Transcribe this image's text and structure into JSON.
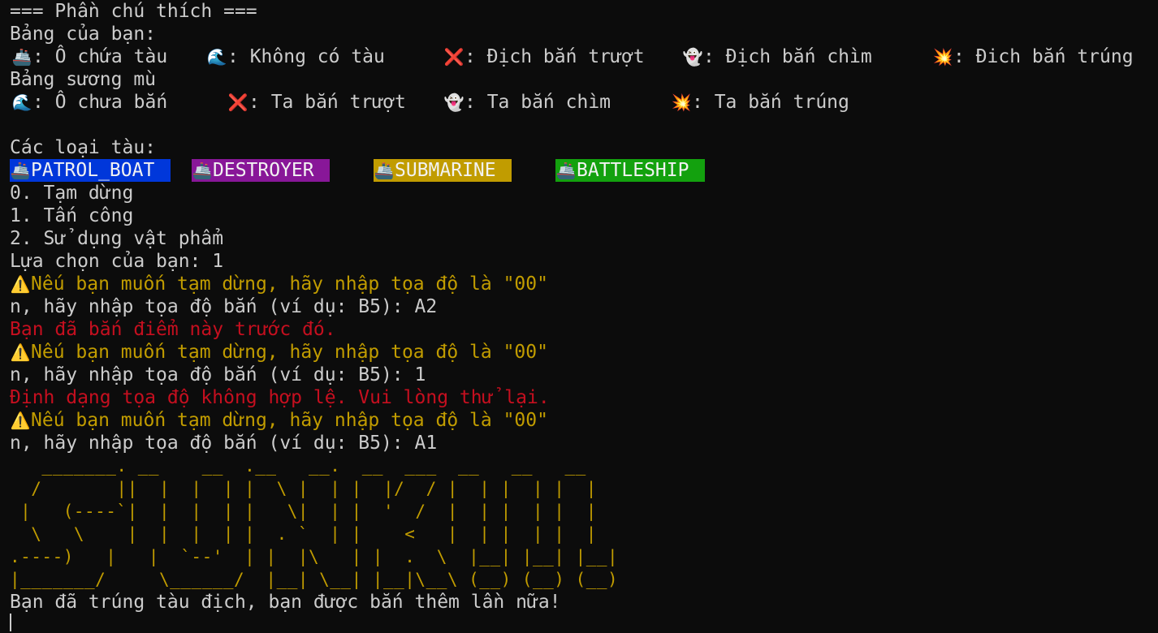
{
  "legend": {
    "header": "=== Phần chú thích ===",
    "own_board_title": "Bảng của bạn:",
    "own_board_items": [
      {
        "icon": "ship-icon",
        "glyph": "🚢",
        "text": ": Ô chứa tàu"
      },
      {
        "icon": "wave-icon",
        "glyph": "🌊",
        "text": ": Không có tàu"
      },
      {
        "icon": "cross-icon",
        "glyph": "❌",
        "text": ": Địch bắn trượt"
      },
      {
        "icon": "ghost-icon",
        "glyph": "👻",
        "text": ": Địch bắn chìm"
      },
      {
        "icon": "explosion-icon",
        "glyph": "💥",
        "text": ": Đich bắn trúng"
      }
    ],
    "fog_board_title": "Bảng sương mù",
    "fog_board_items": [
      {
        "icon": "wave-icon",
        "glyph": "🌊",
        "text": ": Ô chưa bắn"
      },
      {
        "icon": "cross-icon",
        "glyph": "❌",
        "text": ": Ta bắn trượt"
      },
      {
        "icon": "ghost-icon",
        "glyph": "👻",
        "text": ": Ta bắn chìm"
      },
      {
        "icon": "explosion-icon",
        "glyph": "💥",
        "text": ": Ta bắn trúng"
      }
    ]
  },
  "ships": {
    "title": "Các loại tàu:",
    "items": [
      {
        "glyph": "🚢",
        "name": "PATROL_BOAT",
        "color": "#0037da"
      },
      {
        "glyph": "🚢",
        "name": "DESTROYER",
        "color": "#881798"
      },
      {
        "glyph": "🚢",
        "name": "SUBMARINE",
        "color": "#c19c00"
      },
      {
        "glyph": "🚢",
        "name": "BATTLESHIP",
        "color": "#13a10e"
      }
    ]
  },
  "menu": {
    "options": [
      "0. Tạm dừng",
      "1. Tấn công",
      "2. Sử dụng vật phẩm"
    ],
    "prompt": "Lựa chọn của bạn: 1"
  },
  "log": [
    {
      "type": "warn",
      "glyph": "⚠️",
      "text": "Nếu bạn muốn tạm dừng, hãy nhập tọa độ là \"00\""
    },
    {
      "type": "normal",
      "text": "n, hãy nhập tọa độ bắn (ví dụ: B5): A2"
    },
    {
      "type": "err",
      "text": "Bạn đã bắn điểm này trước đó."
    },
    {
      "type": "warn",
      "glyph": "⚠️",
      "text": "Nếu bạn muốn tạm dừng, hãy nhập tọa độ là \"00\""
    },
    {
      "type": "normal",
      "text": "n, hãy nhập tọa độ bắn (ví dụ: B5): 1"
    },
    {
      "type": "err",
      "text": "Định dạng tọa độ không hợp lệ. Vui lòng thử lại."
    },
    {
      "type": "warn",
      "glyph": "⚠️",
      "text": "Nếu bạn muốn tạm dừng, hãy nhập tọa độ là \"00\""
    },
    {
      "type": "normal",
      "text": "n, hãy nhập tọa độ bắn (ví dụ: B5): A1"
    }
  ],
  "ascii_art": [
    "   _______. __    __  .__   __.  __  ___  __   __   __ ",
    "  /       ||  |  |  | |  \\ |  | |  |/  / |  | |  | |  |",
    " |   (----`|  |  |  | |   \\|  | |  '  /  |  | |  | |  |",
    "  \\   \\    |  |  |  | |  . `  | |    <   |  | |  | |  |",
    ".----)   |   |  `--'  | |  |\\   | |  .  \\  |__| |__| |__|",
    "|_______/     \\______/  |__| \\__| |__|\\__\\ (__) (__) (__)"
  ],
  "result": "Bạn đã trúng tàu địch, bạn được bắn thêm lần nữa!",
  "colors": {
    "background": "#0c0c0c",
    "text": "#cccccc",
    "warning": "#c19c00",
    "error": "#c50f1f"
  }
}
